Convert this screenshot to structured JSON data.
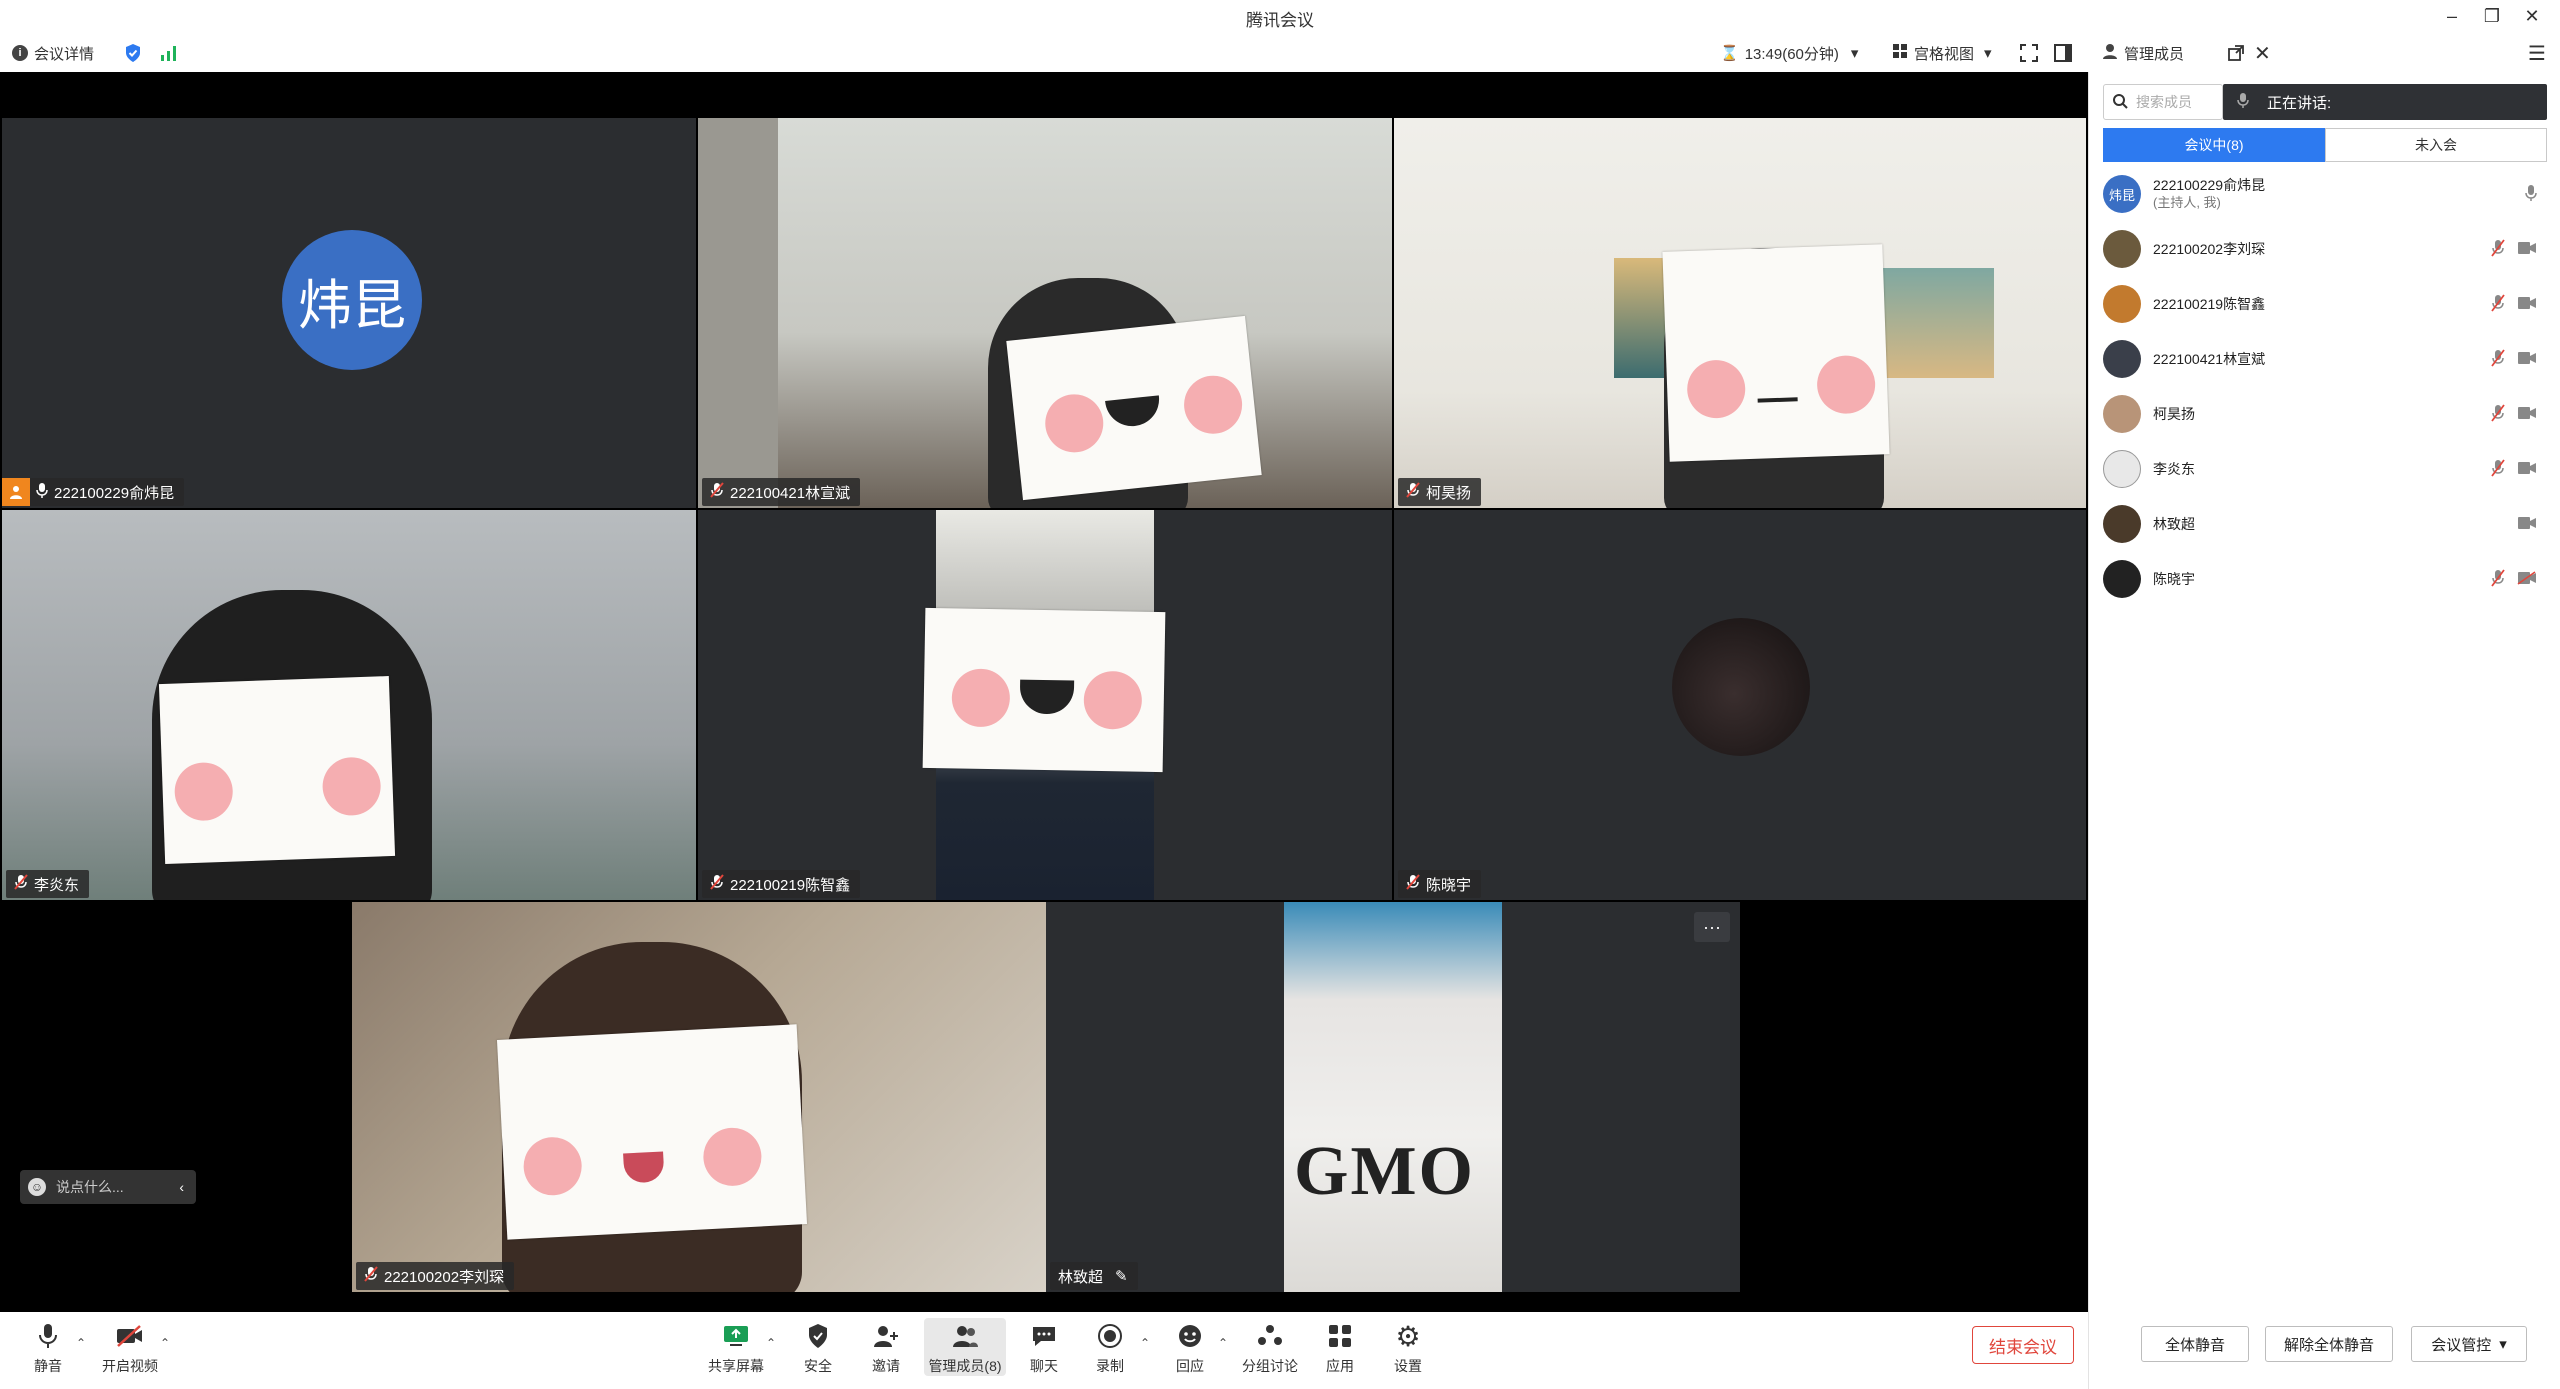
{
  "window": {
    "title": "腾讯会议"
  },
  "toolbar": {
    "meeting_info": "会议详情",
    "timer": "13:49(60分钟)",
    "view_mode": "宫格视图"
  },
  "panel": {
    "title": "管理成员",
    "search_placeholder": "搜索成员",
    "speaking_label": "正在讲话:",
    "tab_in_meeting": "会议中(8)",
    "tab_not_joined": "未入会",
    "members": [
      {
        "name": "222100229俞炜昆",
        "sub": "(主持人, 我)",
        "avatar_text": "炜昆"
      },
      {
        "name": "222100202李刘琛"
      },
      {
        "name": "222100219陈智鑫"
      },
      {
        "name": "222100421林宣斌"
      },
      {
        "name": "柯昊扬"
      },
      {
        "name": "李炎东"
      },
      {
        "name": "林致超"
      },
      {
        "name": "陈晓宇"
      }
    ],
    "mute_all": "全体静音",
    "unmute_all": "解除全体静音",
    "meeting_control": "会议管控"
  },
  "tiles": {
    "t1": {
      "name": "222100229俞炜昆",
      "avatar_text": "炜昆"
    },
    "t2": {
      "name": "222100421林宣斌"
    },
    "t3": {
      "name": "柯昊扬"
    },
    "t4": {
      "name": "李炎东"
    },
    "t5": {
      "name": "222100219陈智鑫"
    },
    "t6": {
      "name": "陈晓宇"
    },
    "t7": {
      "name": "222100202李刘琛"
    },
    "t8": {
      "name": "林致超"
    }
  },
  "chat_input": {
    "placeholder": "说点什么..."
  },
  "bottombar": {
    "mute": "静音",
    "video": "开启视频",
    "share": "共享屏幕",
    "security": "安全",
    "invite": "邀请",
    "members": "管理成员(8)",
    "chat": "聊天",
    "record": "录制",
    "reaction": "回应",
    "breakout": "分组讨论",
    "apps": "应用",
    "settings": "设置",
    "end": "结束会议"
  },
  "colors": {
    "accent": "#2d7af0",
    "end_red": "#e0463c",
    "tile_bg": "#2b2d30"
  }
}
